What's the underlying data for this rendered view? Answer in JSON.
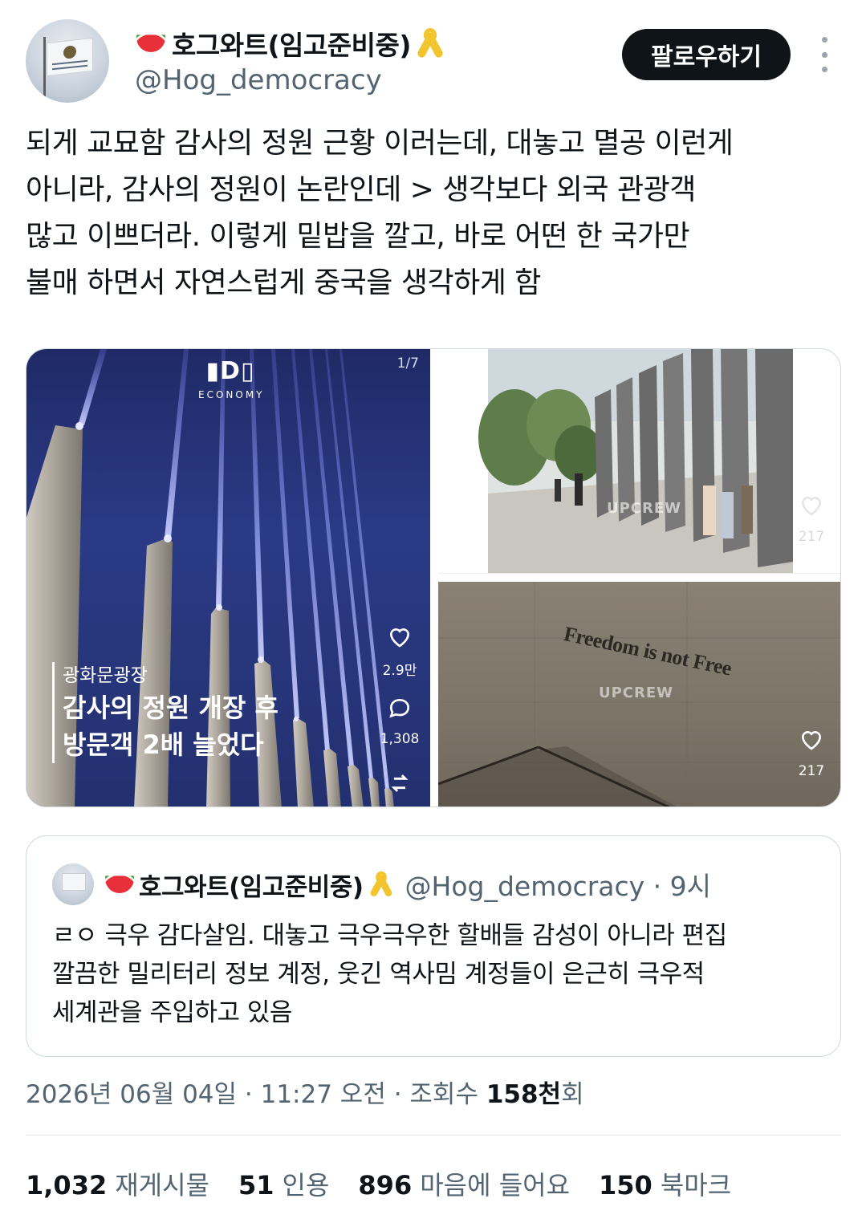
{
  "author": {
    "display_name": "호그와트(임고준비중)",
    "handle": "@Hog_democracy",
    "name_emojis": [
      "watermelon-emoji",
      "yellow-ribbon-emoji"
    ]
  },
  "header": {
    "follow_label": "팔로우하기"
  },
  "tweet": {
    "lines": [
      "되게 교묘함 감사의 정원 근황 이러는데, 대놓고 멸공 이런게",
      "아니라, 감사의 정원이 논란인데 > 생각보다 외국 관광객",
      "많고 이쁘더라. 이렇게 밑밥을 깔고, 바로 어떤 한 국가만",
      "불매 하면서 자연스럽게 중국을 생각하게 함"
    ]
  },
  "media": {
    "left": {
      "counter": "1/7",
      "logo_mark": "▮D▯",
      "logo_word": "ECONOMY",
      "place": "광화문광장",
      "headline_1": "감사의 정원 개장 후",
      "headline_2": "방문객 2배 늘었다",
      "likes": "2.9만",
      "comments": "1,308"
    },
    "right_top": {
      "watermark": "UPCREW",
      "likes": "217"
    },
    "right_bottom": {
      "wall_text": "Freedom is not Free",
      "watermark": "UPCREW",
      "likes": "217"
    }
  },
  "quote": {
    "display_name": "호그와트(임고준비중)",
    "handle_time": "@Hog_democracy · 9시",
    "lines": [
      "ㄹㅇ 극우 감다살임. 대놓고 극우극우한 할배들 감성이 아니라 편집",
      "깔끔한 밀리터리 정보 계정, 웃긴 역사밈 계정들이 은근히 극우적",
      "세계관을 주입하고 있음"
    ]
  },
  "meta": {
    "datetime": "2026년 06월 04일 · 11:27 오전 · 조회수 ",
    "views": "158천",
    "views_suffix": "회"
  },
  "stats": {
    "reposts_num": "1,032",
    "reposts_label": "재게시물",
    "quotes_num": "51",
    "quotes_label": "인용",
    "likes_num": "896",
    "likes_label": "마음에 들어요",
    "bookmarks_num": "150",
    "bookmarks_label": "북마크"
  }
}
